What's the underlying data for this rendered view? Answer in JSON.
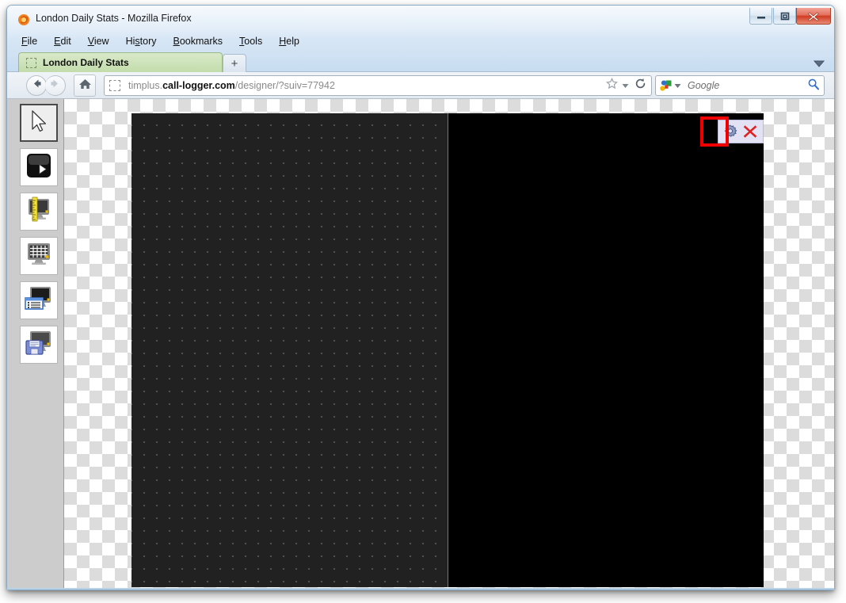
{
  "window": {
    "title": "London Daily Stats - Mozilla Firefox",
    "app_icon": "firefox-icon",
    "controls": {
      "minimize": "minimize-icon",
      "maximize": "restore-icon",
      "close": "close-icon",
      "close_label": "X"
    }
  },
  "menubar": {
    "items": [
      {
        "label": "File",
        "accesskey": "F"
      },
      {
        "label": "Edit",
        "accesskey": "E"
      },
      {
        "label": "View",
        "accesskey": "V"
      },
      {
        "label": "History",
        "accesskey": "s"
      },
      {
        "label": "Bookmarks",
        "accesskey": "B"
      },
      {
        "label": "Tools",
        "accesskey": "T"
      },
      {
        "label": "Help",
        "accesskey": "H"
      }
    ]
  },
  "tabs": {
    "active": {
      "title": "London Daily Stats",
      "favicon": "placeholder-favicon"
    },
    "new_tab_label": "+",
    "list_all_tabs_icon": "chevron-down-icon"
  },
  "navbar": {
    "back_icon": "arrow-left-icon",
    "forward_icon": "arrow-right-icon",
    "home_icon": "home-icon",
    "url": {
      "favicon": "placeholder-favicon",
      "prefix": "timplus.",
      "domain": "call-logger.com",
      "suffix": "/designer/?suiv=77942",
      "full": "timplus.call-logger.com/designer/?suiv=77942",
      "bookmark_icon": "star-icon",
      "bookmark_dropdown_icon": "chevron-down-icon",
      "reload_icon": "reload-icon"
    },
    "search": {
      "engine": "Google",
      "engine_icon": "google-icon",
      "dropdown_icon": "chevron-down-icon",
      "go_icon": "magnifier-icon",
      "placeholder": "Google"
    }
  },
  "toolpalette": {
    "items": [
      {
        "name": "select-tool",
        "icon": "cursor-arrow-icon",
        "selected": true
      },
      {
        "name": "preview-tool",
        "icon": "play-screen-icon",
        "selected": false
      },
      {
        "name": "measure-tool",
        "icon": "ruler-monitor-icon",
        "selected": false
      },
      {
        "name": "grid-tool",
        "icon": "grid-monitor-icon",
        "selected": false
      },
      {
        "name": "properties-tool",
        "icon": "list-monitor-icon",
        "selected": false
      },
      {
        "name": "save-tool",
        "icon": "floppy-monitor-icon",
        "selected": false
      }
    ]
  },
  "canvas": {
    "background_color": "#000000",
    "grid_panel_color": "#212121",
    "grid_dot_color": "#ffffff",
    "widget_toolbar": {
      "settings_icon": "gear-icon",
      "close_icon": "red-x-icon",
      "background_color": "#e2e2f4"
    },
    "annotation": {
      "type": "highlight-rectangle",
      "color": "#f00000",
      "target": "gear-icon"
    }
  }
}
